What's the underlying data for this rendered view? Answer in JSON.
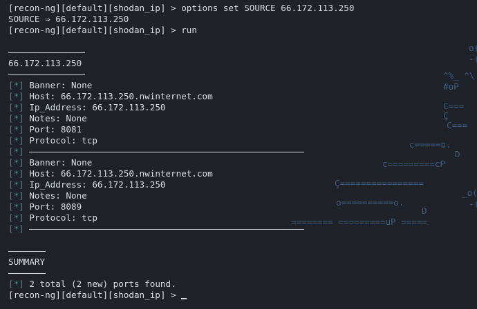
{
  "terminal": {
    "prompt": "[recon-ng][default][shodan_ip] > ",
    "cmd1": "options set SOURCE 66.172.113.250",
    "source_line": "SOURCE ⇒ 66.172.113.250",
    "cmd2": "run",
    "section_title": "66.172.113.250",
    "star": "[*]",
    "results": [
      {
        "banner": "Banner: None",
        "host": "Host: 66.172.113.250.nwinternet.com",
        "ip": "Ip_Address: 66.172.113.250",
        "notes": "Notes: None",
        "port": "Port: 8081",
        "protocol": "Protocol: tcp"
      },
      {
        "banner": "Banner: None",
        "host": "Host: 66.172.113.250.nwinternet.com",
        "ip": "Ip_Address: 66.172.113.250",
        "notes": "Notes: None",
        "port": "Port: 8089",
        "protocol": "Protocol: tcp"
      }
    ],
    "summary_title": "SUMMARY",
    "summary": "2 total (2 new) ports found."
  },
  "colors": {
    "background": "#1f2229",
    "text": "#d8dde4",
    "bracket": "#3a8f8c",
    "watermark": "#3e5f82"
  },
  "background_art": [
    "o(",
    "-(",
    "^%_ ^\\",
    "#oP",
    "C===",
    "Ç",
    "C===",
    "c=====o.",
    "D",
    "c=========cP",
    "Ç================",
    "_o(",
    "o==========o.",
    "D",
    "======== =========uP =====",
    "-("
  ]
}
